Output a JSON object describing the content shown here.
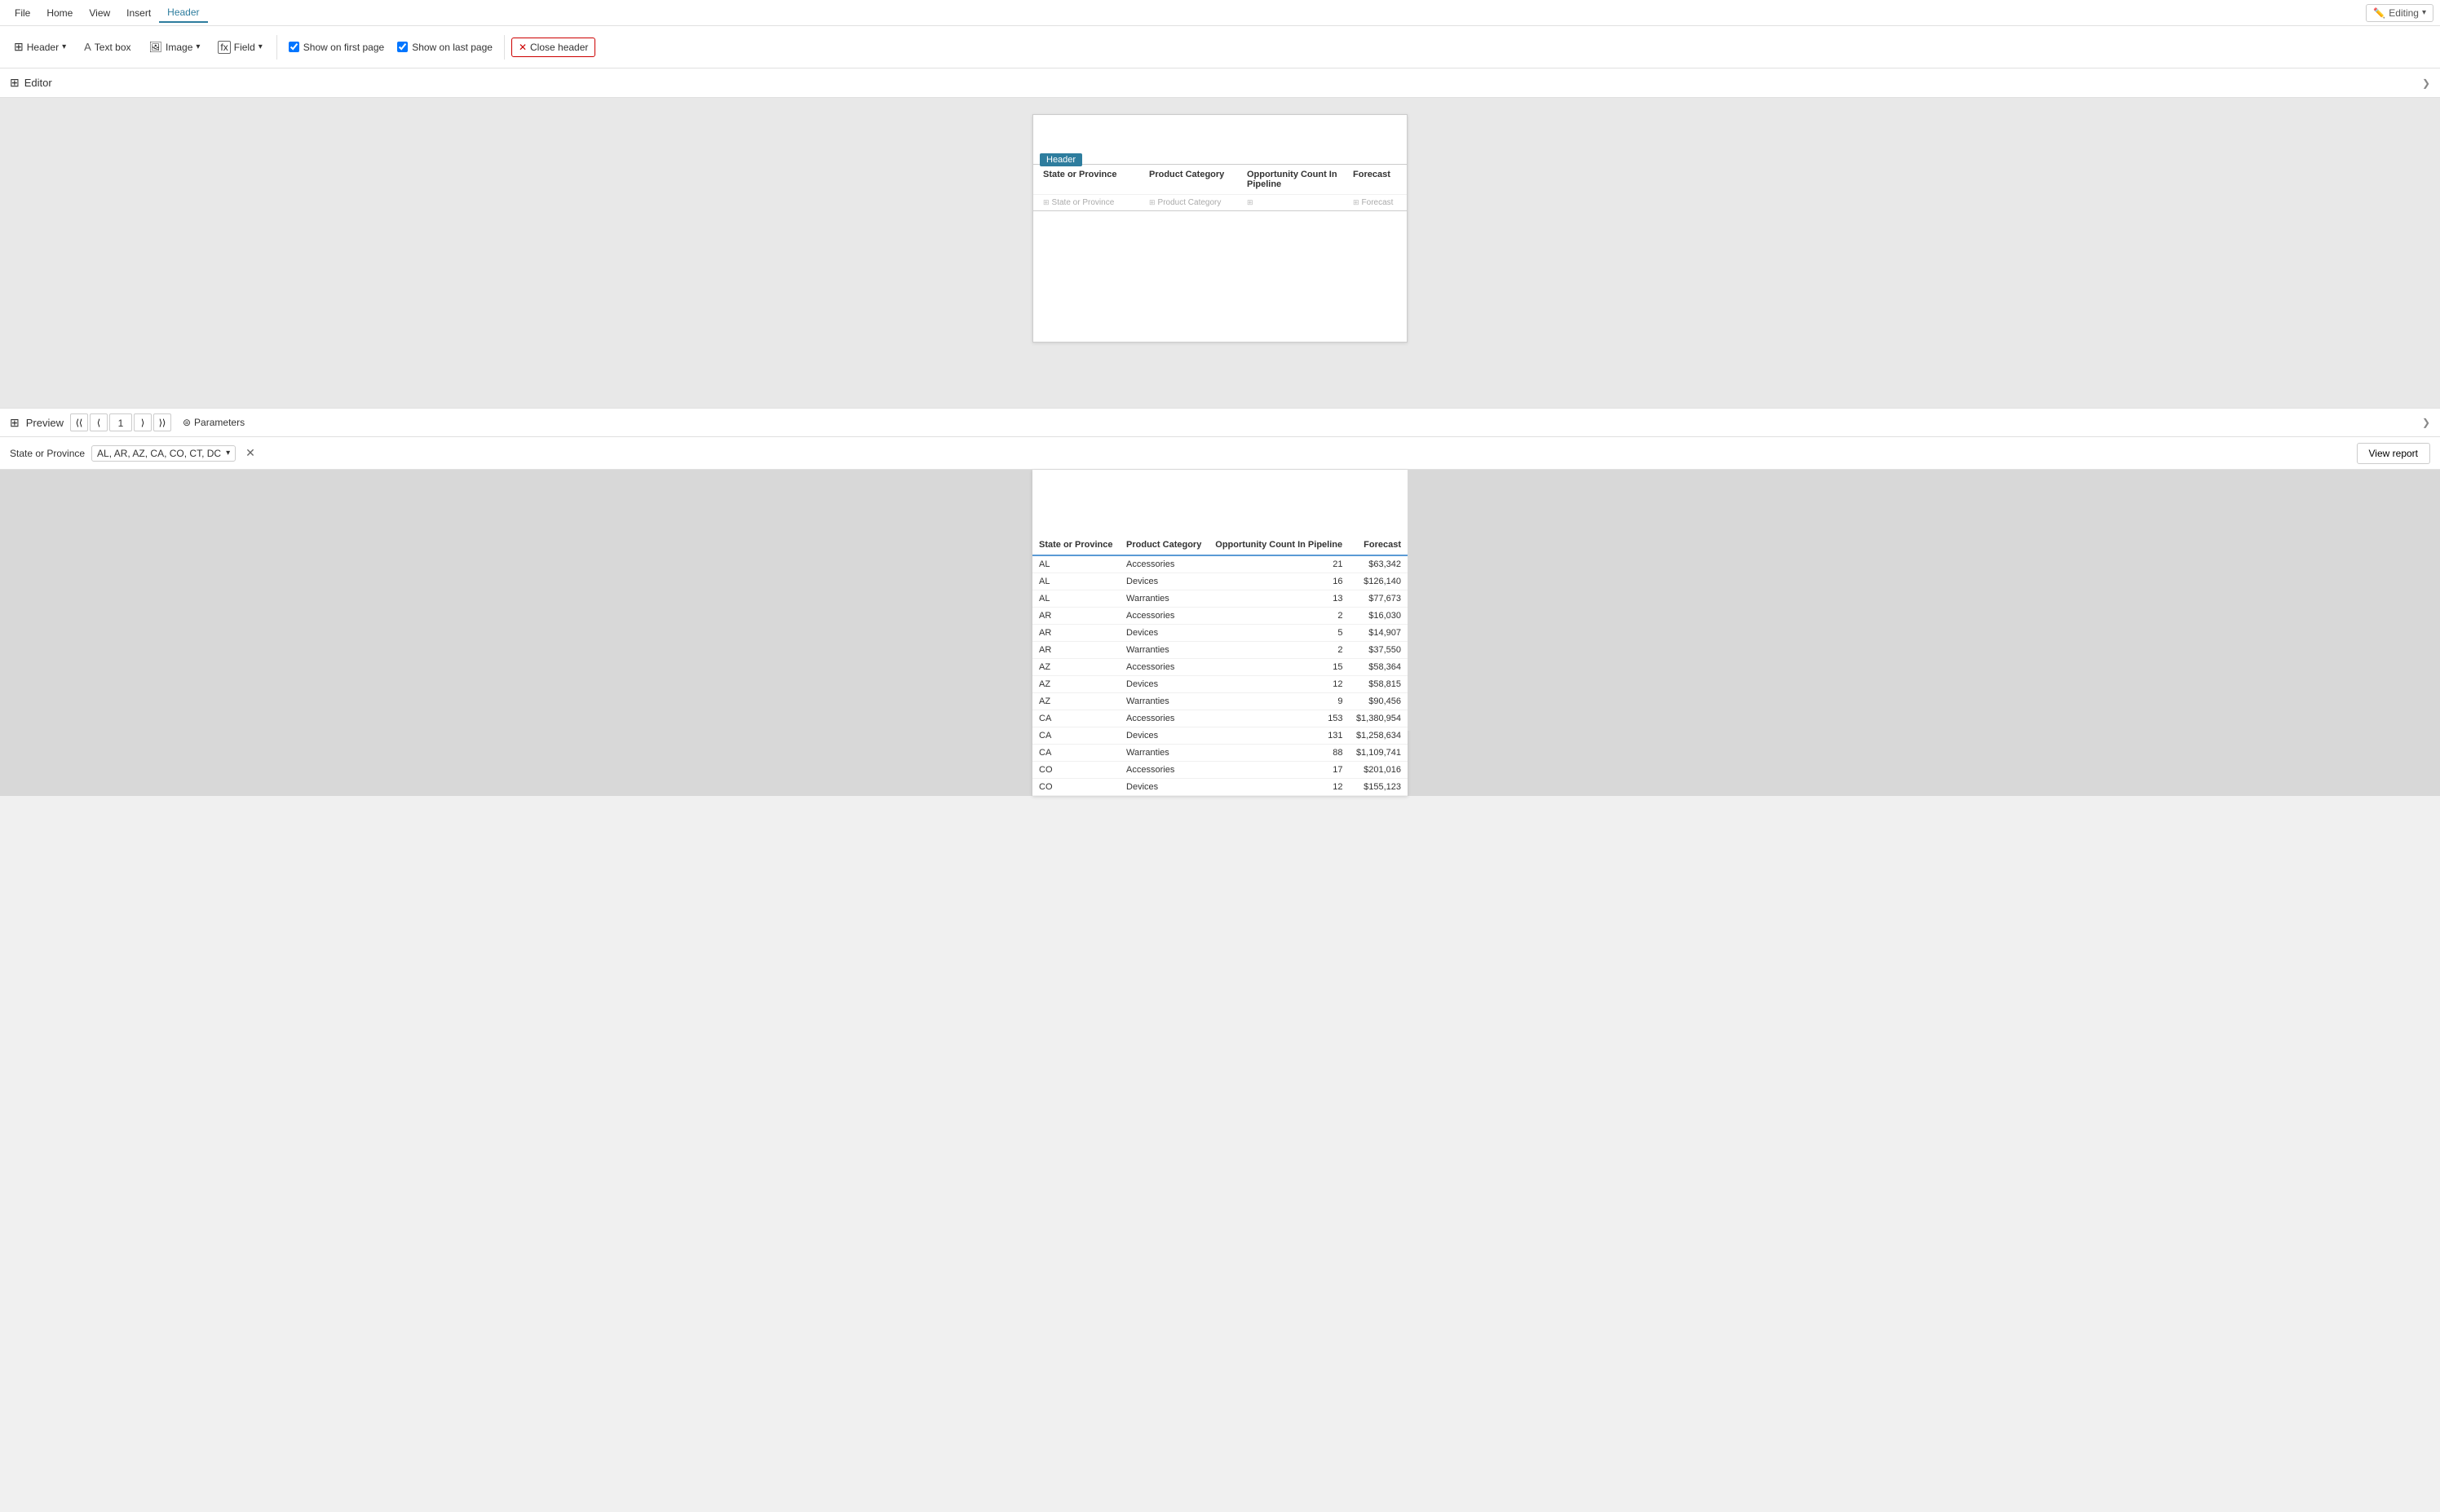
{
  "menu": {
    "items": [
      "File",
      "Home",
      "View",
      "Insert",
      "Header"
    ]
  },
  "editing_badge": {
    "label": "Editing",
    "icon": "pencil-icon"
  },
  "ribbon": {
    "header_btn": "Header",
    "text_box_btn": "Text box",
    "image_btn": "Image",
    "field_btn": "Field",
    "show_first_page_label": "Show on first page",
    "show_last_page_label": "Show on last page",
    "close_header_label": "Close header",
    "show_first_page_checked": true,
    "show_last_page_checked": true
  },
  "section_bar": {
    "label": "Editor"
  },
  "editor": {
    "header_badge": "Header",
    "table_columns": [
      "State or Province",
      "Product Category",
      "Opportunity Count In Pipeline",
      "Forecast"
    ],
    "cell_placeholders": [
      "State or Province",
      "Product Category",
      "",
      "Forecast"
    ]
  },
  "preview_bar": {
    "label": "Preview",
    "page_current": "1",
    "parameters_label": "Parameters"
  },
  "params_bar": {
    "label": "State or Province",
    "value": "AL, AR, AZ, CA, CO, CT, DC",
    "view_report_btn": "View report"
  },
  "preview_table": {
    "columns": [
      "State or Province",
      "Product Category",
      "Opportunity Count In Pipeline",
      "Forecast"
    ],
    "rows": [
      [
        "AL",
        "Accessories",
        "21",
        "$63,342"
      ],
      [
        "AL",
        "Devices",
        "16",
        "$126,140"
      ],
      [
        "AL",
        "Warranties",
        "13",
        "$77,673"
      ],
      [
        "AR",
        "Accessories",
        "2",
        "$16,030"
      ],
      [
        "AR",
        "Devices",
        "5",
        "$14,907"
      ],
      [
        "AR",
        "Warranties",
        "2",
        "$37,550"
      ],
      [
        "AZ",
        "Accessories",
        "15",
        "$58,364"
      ],
      [
        "AZ",
        "Devices",
        "12",
        "$58,815"
      ],
      [
        "AZ",
        "Warranties",
        "9",
        "$90,456"
      ],
      [
        "CA",
        "Accessories",
        "153",
        "$1,380,954"
      ],
      [
        "CA",
        "Devices",
        "131",
        "$1,258,634"
      ],
      [
        "CA",
        "Warranties",
        "88",
        "$1,109,741"
      ],
      [
        "CO",
        "Accessories",
        "17",
        "$201,016"
      ],
      [
        "CO",
        "Devices",
        "12",
        "$155,123"
      ]
    ]
  }
}
